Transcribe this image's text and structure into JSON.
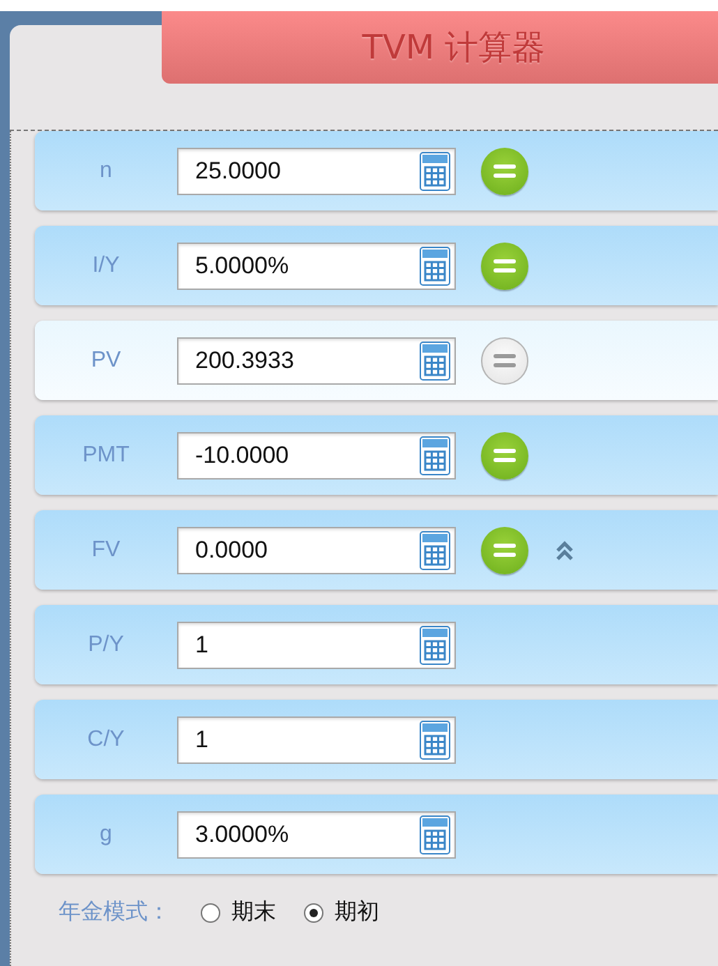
{
  "header": {
    "title": "TVM 计算器"
  },
  "rows": [
    {
      "label": "n",
      "value": "25.0000",
      "selected": false,
      "equals_button": {
        "disabled": false
      },
      "collapse": false
    },
    {
      "label": "I/Y",
      "value": "5.0000%",
      "selected": false,
      "equals_button": {
        "disabled": false
      },
      "collapse": false
    },
    {
      "label": "PV",
      "value": "200.3933",
      "selected": true,
      "equals_button": {
        "disabled": true
      },
      "collapse": false
    },
    {
      "label": "PMT",
      "value": "-10.0000",
      "selected": false,
      "equals_button": {
        "disabled": false
      },
      "collapse": false
    },
    {
      "label": "FV",
      "value": "0.0000",
      "selected": false,
      "equals_button": {
        "disabled": false
      },
      "collapse": true
    },
    {
      "label": "P/Y",
      "value": "1",
      "selected": false,
      "collapse": false
    },
    {
      "label": "C/Y",
      "value": "1",
      "selected": false,
      "collapse": false
    },
    {
      "label": "g",
      "value": "3.0000%",
      "selected": false,
      "collapse": false
    }
  ],
  "annuity_mode": {
    "label": "年金模式：",
    "options": [
      {
        "label": "期末",
        "selected": false
      },
      {
        "label": "期初",
        "selected": true
      }
    ]
  }
}
